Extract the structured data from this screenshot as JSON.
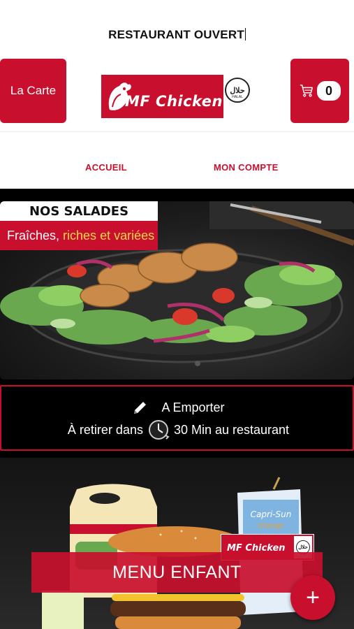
{
  "status": {
    "text": "RESTAURANT OUVERT"
  },
  "header": {
    "carte_label": "La Carte",
    "cart_count": "0",
    "logo_text": "MF Chicken",
    "halal_text": "حلال",
    "halal_small": "HALAL"
  },
  "nav": {
    "items": [
      {
        "label": "ACCUEIL"
      },
      {
        "label": "MON COMPTE"
      }
    ]
  },
  "banner": {
    "title": "NOS SALADES",
    "subtitle_white": "Fraîches,",
    "subtitle_yellow": "riches et variées"
  },
  "order_mode": {
    "mode_label": "A Emporter",
    "pickup_prefix": "À retirer dans",
    "pickup_time": "30 Min au restaurant"
  },
  "menu_card": {
    "label": "MENU ENFANT",
    "mini_logo_text": "MF Chicken",
    "drink_text": "Capri-Sun"
  },
  "fab": {
    "label": "+"
  },
  "colors": {
    "brand_red": "#c8102e",
    "accent_yellow": "#ffd54a"
  }
}
